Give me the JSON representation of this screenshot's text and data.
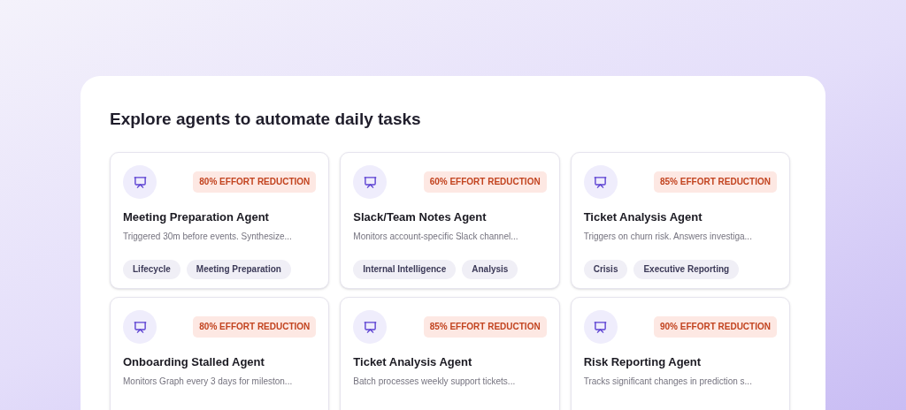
{
  "heading": "Explore agents to automate daily tasks",
  "agents": [
    {
      "badge": "80% EFFORT REDUCTION",
      "title": "Meeting Preparation Agent",
      "description": "Triggered 30m before events. Synthesize...",
      "tags": [
        "Lifecycle",
        "Meeting Preparation"
      ]
    },
    {
      "badge": "60% EFFORT REDUCTION",
      "title": "Slack/Team Notes Agent",
      "description": "Monitors account-specific Slack channel...",
      "tags": [
        "Internal Intelligence",
        "Analysis"
      ]
    },
    {
      "badge": "85% EFFORT REDUCTION",
      "title": "Ticket Analysis Agent",
      "description": "Triggers on churn risk. Answers investiga...",
      "tags": [
        "Crisis",
        "Executive Reporting"
      ]
    },
    {
      "badge": "80% EFFORT REDUCTION",
      "title": "Onboarding Stalled Agent",
      "description": "Monitors Graph every 3 days for mileston..."
    },
    {
      "badge": "85% EFFORT REDUCTION",
      "title": "Ticket Analysis Agent",
      "description": "Batch processes weekly support tickets..."
    },
    {
      "badge": "90% EFFORT REDUCTION",
      "title": "Risk Reporting Agent",
      "description": "Tracks significant changes in prediction s..."
    }
  ]
}
